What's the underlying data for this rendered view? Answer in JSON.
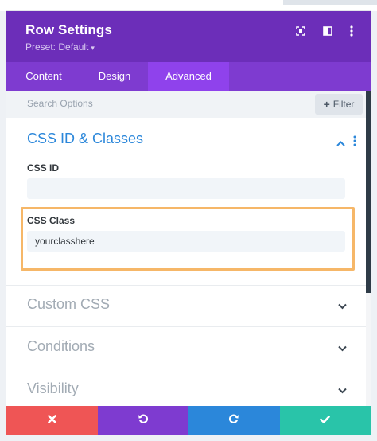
{
  "header": {
    "title": "Row Settings",
    "preset_label": "Preset: Default",
    "preset_caret": "▾",
    "icons": [
      "expand-icon",
      "sidebar-layout-icon",
      "more-options-icon"
    ]
  },
  "tabs": [
    {
      "label": "Content",
      "active": false
    },
    {
      "label": "Design",
      "active": false
    },
    {
      "label": "Advanced",
      "active": true
    }
  ],
  "search": {
    "placeholder": "Search Options",
    "filter_label": "Filter",
    "filter_icon": "+"
  },
  "section": {
    "title": "CSS ID & Classes",
    "expanded": true,
    "fields": [
      {
        "label": "CSS ID",
        "value": ""
      },
      {
        "label": "CSS Class",
        "value": "yourclasshere"
      }
    ]
  },
  "groups": [
    {
      "label": "Custom CSS"
    },
    {
      "label": "Conditions"
    },
    {
      "label": "Visibility"
    }
  ],
  "footer": {
    "buttons": [
      {
        "name": "discard-button",
        "icon": "close-icon",
        "color": "#ef5555"
      },
      {
        "name": "undo-button",
        "icon": "undo-icon",
        "color": "#7e3bd0"
      },
      {
        "name": "redo-button",
        "icon": "redo-icon",
        "color": "#2b87da"
      },
      {
        "name": "save-button",
        "icon": "check-icon",
        "color": "#29c4a9"
      }
    ]
  },
  "colors": {
    "header_bg": "#6c2eb9",
    "tabs_bg": "#7e3bd0",
    "tab_active_bg": "#8f42ec",
    "accent_blue": "#2b87da",
    "highlight_border": "#f6b768"
  }
}
